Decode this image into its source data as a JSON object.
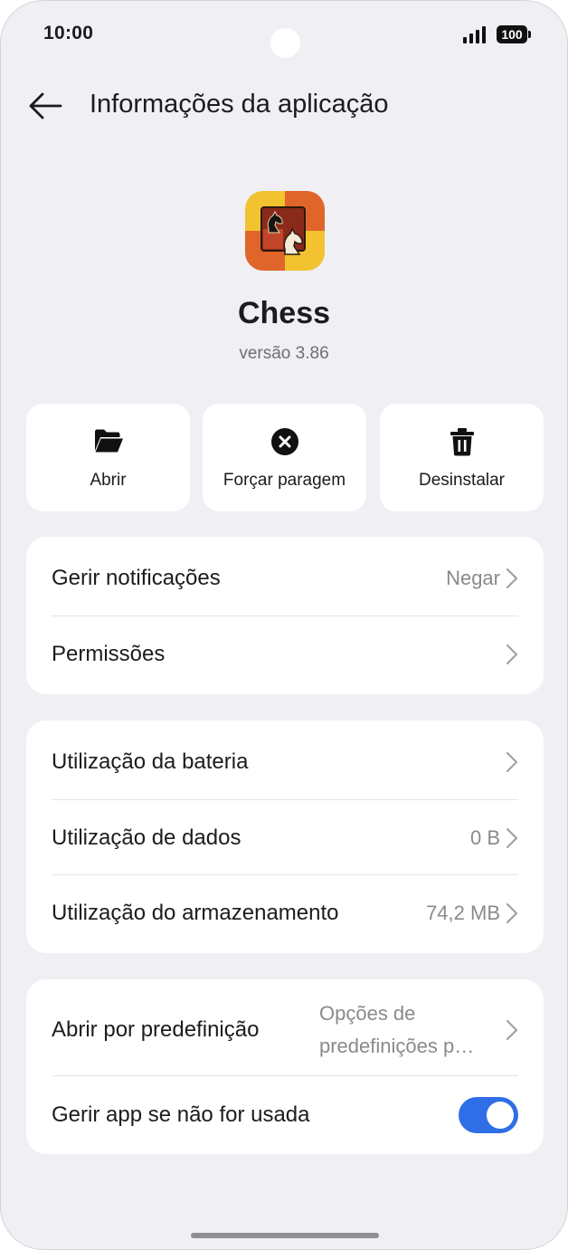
{
  "status_bar": {
    "time": "10:00",
    "battery": "100"
  },
  "header": {
    "title": "Informações da aplicação"
  },
  "app": {
    "name": "Chess",
    "version": "versão 3.86"
  },
  "actions": {
    "open": "Abrir",
    "force_stop": "Forçar paragem",
    "uninstall": "Desinstalar"
  },
  "group1": {
    "notifications": {
      "label": "Gerir notificações",
      "value": "Negar"
    },
    "permissions": {
      "label": "Permissões"
    }
  },
  "group2": {
    "battery": {
      "label": "Utilização da bateria"
    },
    "data": {
      "label": "Utilização de dados",
      "value": "0 B"
    },
    "storage": {
      "label": "Utilização do armazenamento",
      "value": "74,2 MB"
    }
  },
  "group3": {
    "open_default": {
      "label": "Abrir por predefinição",
      "value_line1": "Opções de",
      "value_line2": "predefinições p…"
    },
    "manage_unused": {
      "label": "Gerir app se não for usada",
      "enabled": true
    }
  },
  "colors": {
    "toggle_on": "#2f6ee6",
    "background": "#efeff4"
  }
}
